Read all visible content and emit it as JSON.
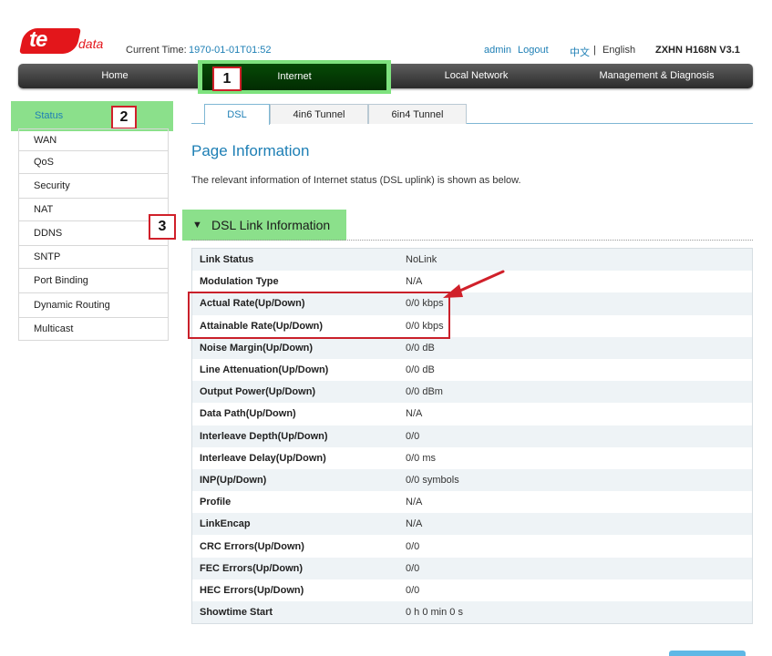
{
  "brand": {
    "logo_text": "te",
    "logo_suffix": "data",
    "accent": "#e3161b"
  },
  "header": {
    "time_label": "Current Time:",
    "time_value": "1970-01-01T01:52",
    "user": "admin",
    "logout": "Logout",
    "lang_cn": "中文",
    "lang_sep": "|",
    "lang_en": "English",
    "model": "ZXHN H168N V3.1"
  },
  "nav": {
    "home": "Home",
    "internet": "Internet",
    "local": "Local Network",
    "mgmt": "Management & Diagnosis"
  },
  "annotations": {
    "n1": "1",
    "n2": "2",
    "n3": "3"
  },
  "sidebar": {
    "items": [
      {
        "label": "Status"
      },
      {
        "label": "WAN"
      },
      {
        "label": "QoS"
      },
      {
        "label": "Security"
      },
      {
        "label": "NAT"
      },
      {
        "label": "DDNS"
      },
      {
        "label": "SNTP"
      },
      {
        "label": "Port Binding"
      },
      {
        "label": "Dynamic Routing"
      },
      {
        "label": "Multicast"
      }
    ]
  },
  "tabs": [
    {
      "label": "DSL"
    },
    {
      "label": "4in6 Tunnel"
    },
    {
      "label": "6in4 Tunnel"
    }
  ],
  "page": {
    "title": "Page Information",
    "description": "The relevant information of Internet status (DSL uplink) is shown as below."
  },
  "section": {
    "caret": "▼",
    "title": "DSL Link Information"
  },
  "table": [
    {
      "label": "Link Status",
      "value": "NoLink"
    },
    {
      "label": "Modulation Type",
      "value": "N/A"
    },
    {
      "label": "Actual Rate(Up/Down)",
      "value": "0/0 kbps"
    },
    {
      "label": "Attainable Rate(Up/Down)",
      "value": "0/0 kbps"
    },
    {
      "label": "Noise Margin(Up/Down)",
      "value": "0/0 dB"
    },
    {
      "label": "Line Attenuation(Up/Down)",
      "value": "0/0 dB"
    },
    {
      "label": "Output Power(Up/Down)",
      "value": "0/0 dBm"
    },
    {
      "label": "Data Path(Up/Down)",
      "value": "N/A"
    },
    {
      "label": "Interleave Depth(Up/Down)",
      "value": "0/0"
    },
    {
      "label": "Interleave Delay(Up/Down)",
      "value": "0/0 ms"
    },
    {
      "label": "INP(Up/Down)",
      "value": "0/0 symbols"
    },
    {
      "label": "Profile",
      "value": "N/A"
    },
    {
      "label": "LinkEncap",
      "value": "N/A"
    },
    {
      "label": "CRC Errors(Up/Down)",
      "value": "0/0"
    },
    {
      "label": "FEC Errors(Up/Down)",
      "value": "0/0"
    },
    {
      "label": "HEC Errors(Up/Down)",
      "value": "0/0"
    },
    {
      "label": "Showtime Start",
      "value": "0 h 0 min 0 s"
    }
  ]
}
